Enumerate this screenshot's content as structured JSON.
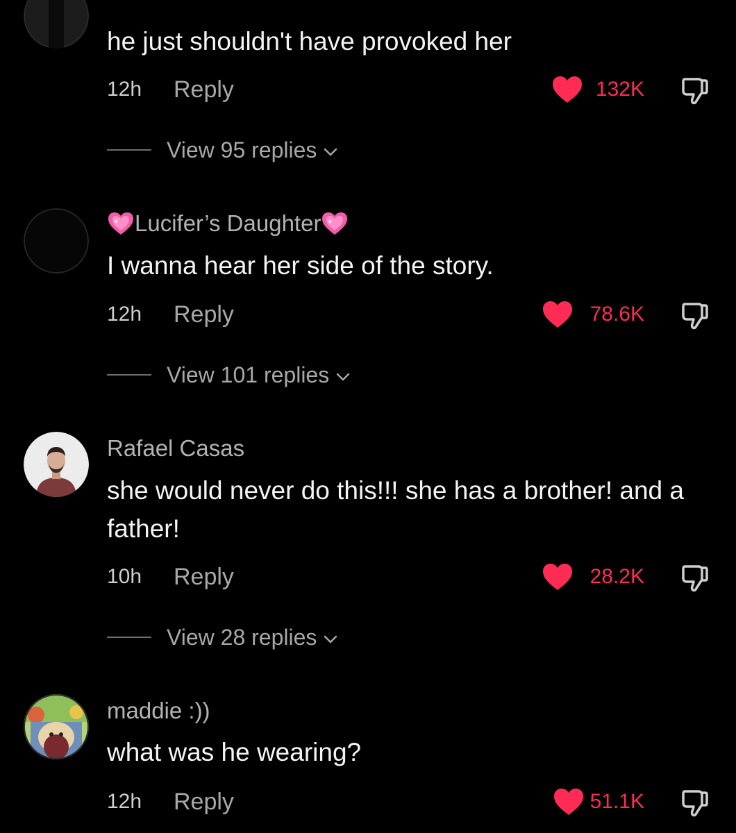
{
  "colors": {
    "background": "#000000",
    "like_red": "#fe2c55",
    "secondary_text": "#a8a8a8"
  },
  "comments": [
    {
      "username": "",
      "text": "he just shouldn't have provoked her",
      "time": "12h",
      "reply_label": "Reply",
      "likes": "132K",
      "view_replies": "View 95 replies",
      "avatar_icon": "avatar-dark"
    },
    {
      "username": "Lucifer’s Daughter",
      "username_emoji": "sparkling-heart-icon",
      "text": "I wanna hear her side of the story.",
      "time": "12h",
      "reply_label": "Reply",
      "likes": "78.6K",
      "view_replies": "View 101 replies",
      "avatar_icon": "avatar-black"
    },
    {
      "username": "Rafael Casas",
      "text": "she would never do this!!! she has a brother! and a father!",
      "time": "10h",
      "reply_label": "Reply",
      "likes": "28.2K",
      "view_replies": "View 28 replies",
      "avatar_icon": "avatar-photo-man"
    },
    {
      "username": "maddie :))",
      "text": "what was he wearing?",
      "time": "12h",
      "reply_label": "Reply",
      "likes": "51.1K",
      "avatar_icon": "avatar-cartoon"
    }
  ]
}
